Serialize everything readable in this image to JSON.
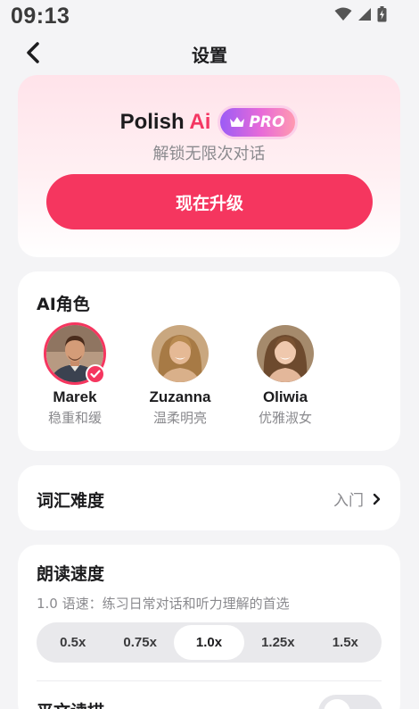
{
  "status_bar": {
    "time": "09:13"
  },
  "header": {
    "title": "设置"
  },
  "promo": {
    "brand": "Polish",
    "brand_accent": "Ai",
    "badge": "PRO",
    "subtitle": "解锁无限次对话",
    "upgrade_label": "现在升级"
  },
  "roles": {
    "title": "AI角色",
    "items": [
      {
        "name": "Marek",
        "desc": "稳重和缓",
        "selected": true
      },
      {
        "name": "Zuzanna",
        "desc": "温柔明亮",
        "selected": false
      },
      {
        "name": "Oliwia",
        "desc": "优雅淑女",
        "selected": false
      }
    ]
  },
  "vocabulary": {
    "title": "词汇难度",
    "value": "入门"
  },
  "reading_speed": {
    "title": "朗读速度",
    "description": "1.0 语速：练习日常对话和听力理解的首选",
    "options": [
      "0.5x",
      "0.75x",
      "1.0x",
      "1.25x",
      "1.5x"
    ],
    "selected": "1.0x"
  },
  "next_setting": {
    "title": "平文读描",
    "enabled": false
  },
  "colors": {
    "accent": "#f5365f",
    "background": "#f4f4f6"
  }
}
